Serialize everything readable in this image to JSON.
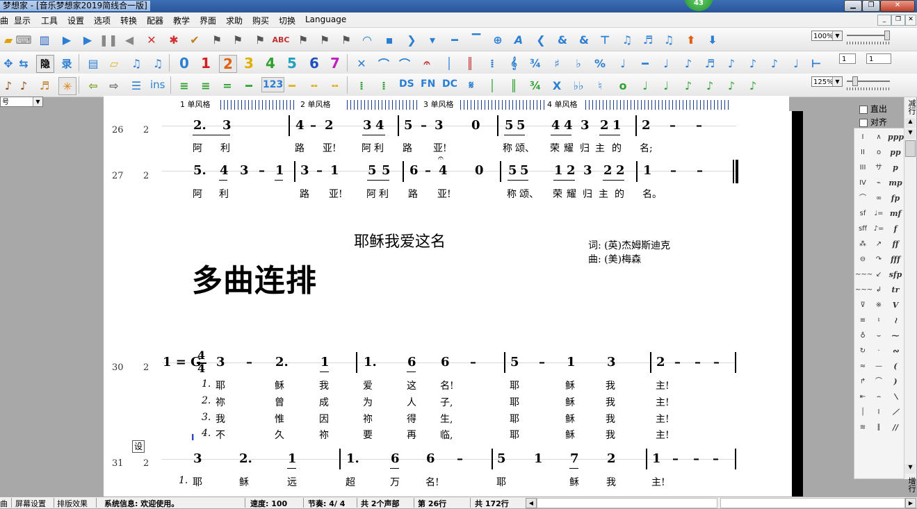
{
  "window": {
    "title": "梦想家 - [音乐梦想家2019简线合一版]",
    "badge": "43"
  },
  "menu": [
    "显示",
    "工具",
    "设置",
    "选项",
    "转换",
    "配器",
    "教学",
    "界面",
    "求助",
    "购买",
    "切换",
    "Language"
  ],
  "menu_left_fragment": "曲",
  "toolbar1": {
    "zoom": "100%"
  },
  "toolbar2": {
    "digits": [
      "0",
      "1",
      "2",
      "3",
      "4",
      "5",
      "6",
      "7"
    ],
    "box1": "1",
    "box2": "1"
  },
  "toolbar3": {
    "ins_label": "ins",
    "num_label": "123",
    "ds": "DS",
    "fn": "FN",
    "dc": "DC",
    "zoom": "125%"
  },
  "left_combo": "号",
  "ruler": {
    "labels": [
      "1 单风格",
      "2 单风格",
      "3 单风格",
      "4 单风格"
    ]
  },
  "panel_checks": [
    {
      "label": "直出",
      "checked": false
    },
    {
      "label": "对齐",
      "checked": false
    }
  ],
  "side_buttons": {
    "top": "减行",
    "bottom": "增行"
  },
  "score": {
    "row26": {
      "line": "26",
      "voice": "2",
      "notes": [
        "2.",
        "3",
        "4",
        "–",
        "2",
        "3",
        "4",
        "5",
        "–",
        "3",
        "0",
        "5",
        "5",
        "4",
        "4",
        "3",
        "2",
        "1",
        "2",
        "–",
        "–"
      ],
      "lyrics": [
        "阿",
        "利",
        "路",
        "亚!",
        "阿",
        "利",
        "路",
        "亚!",
        "称",
        "颂、",
        "荣",
        "耀",
        "归",
        "主",
        "的",
        "名;"
      ]
    },
    "row27": {
      "line": "27",
      "voice": "2",
      "notes": [
        "5.",
        "4",
        "3",
        "–",
        "1",
        "3",
        "–",
        "1",
        "5",
        "5",
        "6",
        "–",
        "4",
        "0",
        "5",
        "5",
        "1",
        "2",
        "3",
        "2",
        "2",
        "1",
        "–",
        "–"
      ],
      "lyrics": [
        "阿",
        "利",
        "路",
        "亚!",
        "阿",
        "利",
        "路",
        "亚!",
        "称",
        "颂、",
        "荣",
        "耀",
        "归",
        "主",
        "的",
        "名。"
      ]
    },
    "song_title": "耶稣我爱这名",
    "credits": {
      "lyrics": "词: (英)杰姆斯迪克",
      "music": "曲: (美)梅森"
    },
    "big_caption": "多曲连排",
    "row30": {
      "line": "30",
      "voice": "2",
      "key": "1 = G",
      "time_top": "4",
      "time_bottom": "4",
      "notes": [
        "3",
        "–",
        "2.",
        "1",
        "1.",
        "6",
        "6",
        "–",
        "5",
        "–",
        "1",
        "3",
        "2",
        "–",
        "–",
        "–"
      ],
      "verses": [
        [
          "1.",
          "耶",
          "稣",
          "我",
          "爱",
          "这",
          "名!",
          "耶",
          "稣",
          "我",
          "主!"
        ],
        [
          "2.",
          "祢",
          "曾",
          "成",
          "为",
          "人",
          "子,",
          "耶",
          "稣",
          "我",
          "主!"
        ],
        [
          "3.",
          "我",
          "惟",
          "因",
          "祢",
          "得",
          "生,",
          "耶",
          "稣",
          "我",
          "主!"
        ],
        [
          "4.",
          "不",
          "久",
          "祢",
          "要",
          "再",
          "临,",
          "耶",
          "稣",
          "我",
          "主!"
        ]
      ]
    },
    "marker_box": "设",
    "cursor": "I",
    "row31": {
      "line": "31",
      "voice": "2",
      "notes": [
        "3",
        "2.",
        "1",
        "1.",
        "6",
        "6",
        "–",
        "5",
        "1",
        "7",
        "2",
        "1",
        "–",
        "–",
        "–"
      ],
      "verse1": [
        "1.",
        "耶",
        "稣",
        "远",
        "超",
        "万",
        "名!",
        "耶",
        "稣",
        "我",
        "主!"
      ]
    }
  },
  "palette": {
    "col1": [
      "I",
      "II",
      "III",
      "IV",
      "⌒",
      "sf",
      "sff",
      "⁂",
      "⊖",
      "~~~",
      "~~~",
      "⊽",
      "≡",
      "♁",
      "↻",
      "≈",
      "↱",
      "⇤",
      "│",
      "≋"
    ],
    "col2": [
      "∧",
      "o",
      "サ",
      "⌁",
      "∞",
      "♩=",
      "♪=",
      "↗",
      "↷",
      "↙",
      "↲",
      "※",
      "♮",
      "⌣",
      "·",
      "—",
      "⌒",
      "⌢",
      "I",
      "∥"
    ],
    "col3": [
      "ppp",
      "pp",
      "p",
      "mp",
      "fp",
      "mf",
      "f",
      "ff",
      "fff",
      "sfp",
      "tr",
      "V",
      "≀",
      "⁓",
      "∾",
      "(",
      ")",
      "⟍",
      "⟋",
      "//"
    ]
  },
  "status": {
    "left": "曲",
    "tabs": [
      "屏幕设置",
      "排版效果"
    ],
    "info": "系统信息: 欢迎使用。",
    "tempo": "速度: 100",
    "meter": "节奏: 4/ 4",
    "parts": "共 2个声部",
    "current_line": "第 26行",
    "total_lines": "共 172行"
  }
}
